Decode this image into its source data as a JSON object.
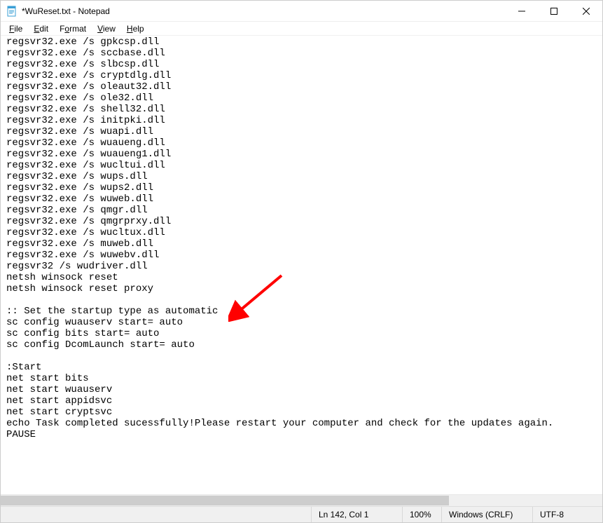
{
  "window": {
    "title": "*WuReset.txt - Notepad"
  },
  "menu": {
    "file": "File",
    "edit": "Edit",
    "format": "Format",
    "view": "View",
    "help": "Help"
  },
  "editor": {
    "content": "regsvr32.exe /s gpkcsp.dll\nregsvr32.exe /s sccbase.dll\nregsvr32.exe /s slbcsp.dll\nregsvr32.exe /s cryptdlg.dll\nregsvr32.exe /s oleaut32.dll\nregsvr32.exe /s ole32.dll\nregsvr32.exe /s shell32.dll\nregsvr32.exe /s initpki.dll\nregsvr32.exe /s wuapi.dll\nregsvr32.exe /s wuaueng.dll\nregsvr32.exe /s wuaueng1.dll\nregsvr32.exe /s wucltui.dll\nregsvr32.exe /s wups.dll\nregsvr32.exe /s wups2.dll\nregsvr32.exe /s wuweb.dll\nregsvr32.exe /s qmgr.dll\nregsvr32.exe /s qmgrprxy.dll\nregsvr32.exe /s wucltux.dll\nregsvr32.exe /s muweb.dll\nregsvr32.exe /s wuwebv.dll\nregsvr32 /s wudriver.dll\nnetsh winsock reset\nnetsh winsock reset proxy\n\n:: Set the startup type as automatic\nsc config wuauserv start= auto\nsc config bits start= auto\nsc config DcomLaunch start= auto\n\n:Start\nnet start bits\nnet start wuauserv\nnet start appidsvc\nnet start cryptsvc\necho Task completed sucessfully!Please restart your computer and check for the updates again.\nPAUSE"
  },
  "status": {
    "position": "Ln 142, Col 1",
    "zoom": "100%",
    "line_endings": "Windows (CRLF)",
    "encoding": "UTF-8"
  },
  "annotation": {
    "arrow_target": ":: Set the startup type as automatic"
  }
}
